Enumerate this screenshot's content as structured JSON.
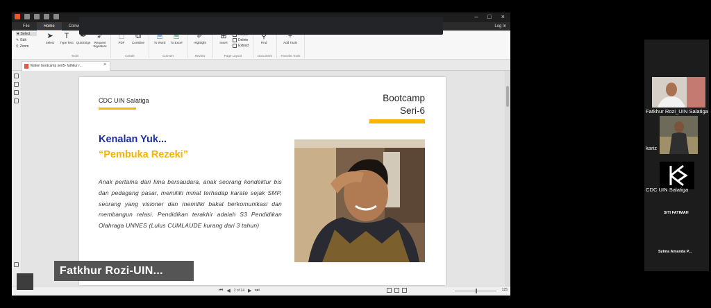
{
  "app": {
    "menu_tabs": [
      "File",
      "Home",
      "Convert"
    ],
    "active_tab": "Home",
    "login": "Log In",
    "tools": {
      "select": "Select",
      "edit": "Edit",
      "zoom": "Zoom"
    },
    "ribbon_groups": [
      {
        "name": "Tools",
        "buttons": [
          {
            "label": "Select",
            "icon": "cursor-icon"
          },
          {
            "label": "Type Text",
            "icon": "text-icon"
          },
          {
            "label": "QuickSign",
            "icon": "pen-icon"
          },
          {
            "label": "Request Signature",
            "icon": "send-icon"
          }
        ]
      },
      {
        "name": "Create",
        "buttons": [
          {
            "label": "PDF",
            "icon": "file-icon"
          },
          {
            "label": "Combine",
            "icon": "combine-icon"
          }
        ]
      },
      {
        "name": "Convert",
        "buttons": [
          {
            "label": "To Word",
            "icon": "word-icon"
          },
          {
            "label": "To Excel",
            "icon": "excel-icon"
          }
        ]
      },
      {
        "name": "Review",
        "buttons": [
          {
            "label": "Highlight",
            "icon": "highlight-icon"
          }
        ]
      },
      {
        "name": "Page Layout",
        "buttons": [
          {
            "label": "Insert",
            "icon": "insert-icon"
          }
        ],
        "small": [
          "Rotate",
          "Delete",
          "Extract"
        ]
      },
      {
        "name": "Document",
        "buttons": [
          {
            "label": "Find",
            "icon": "search-icon"
          }
        ]
      },
      {
        "name": "Favorite Tools",
        "buttons": [
          {
            "label": "Add Tools",
            "icon": "plus-icon"
          }
        ]
      }
    ],
    "doc_tab": "Materi bootcamp seri5- fathkur r..."
  },
  "page": {
    "org": "CDC UIN Salatiga",
    "bootcamp_line1": "Bootcamp",
    "bootcamp_line2": "Seri-6",
    "heading1": "Kenalan Yuk...",
    "heading2": "“Pembuka Rezeki”",
    "bio": "Anak pertama dari lima bersaudara, anak seorang kondektur bis dan pedagang pasar, memiliki minat terhadap karate sejak SMP, seorang yang visioner dan memiliki bakat berkomunikasi dan membangun relasi. Pendidikan terakhir adalah S3 Pendidikan Olahraga UNNES (Lulus CUMLAUDE kurang dari 3 tahun)"
  },
  "status": {
    "page_indicator": "2 of 14",
    "zoom": "125"
  },
  "speaker_overlay": "Fatkhur  Rozi-UIN...",
  "participants": [
    {
      "name": "Fatkhur Rozi_UIN Salatiga",
      "type": "video"
    },
    {
      "name": "kariz",
      "type": "video"
    },
    {
      "name": "CDC UIN Salatiga",
      "type": "logo"
    },
    {
      "name": "SITI FATIMAH",
      "type": "name-only"
    },
    {
      "name": "Sylma Amanda P...",
      "type": "name-only"
    }
  ],
  "colors": {
    "accent_yellow": "#f4b400",
    "heading_blue": "#1b2f9e",
    "app_dark": "#232428"
  }
}
